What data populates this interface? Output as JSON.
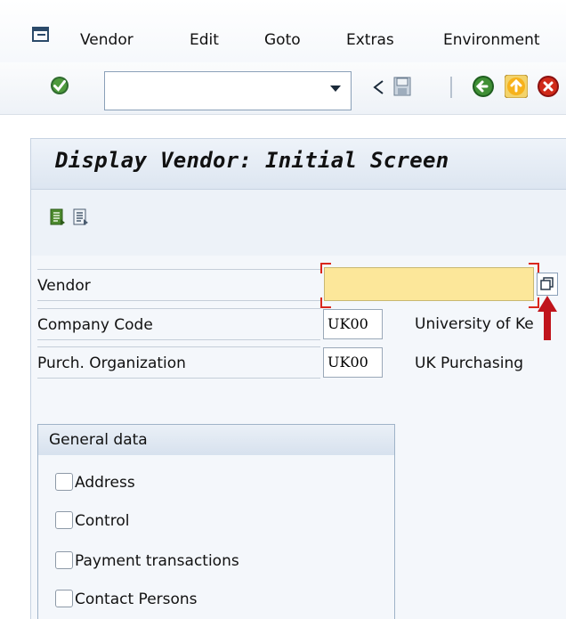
{
  "menubar": {
    "items": [
      {
        "label": "Vendor"
      },
      {
        "label": "Edit"
      },
      {
        "label": "Goto"
      },
      {
        "label": "Extras"
      },
      {
        "label": "Environment"
      }
    ]
  },
  "toolbar": {
    "command_field_value": "",
    "icons": [
      "enter-icon",
      "dropdown-arrow-icon",
      "back-icon",
      "save-icon",
      "back-green-icon",
      "exit-icon",
      "cancel-icon"
    ]
  },
  "title": "Display Vendor:  Initial Screen",
  "fields": {
    "vendor": {
      "label": "Vendor",
      "value": ""
    },
    "company_code": {
      "label": "Company Code",
      "value": "UK00",
      "description": "University of Ke"
    },
    "purch_org": {
      "label": "Purch. Organization",
      "value": "UK00",
      "description": "UK Purchasing"
    }
  },
  "general_data": {
    "title": "General data",
    "items": [
      {
        "label": "Address",
        "checked": false
      },
      {
        "label": "Control",
        "checked": false
      },
      {
        "label": "Payment transactions",
        "checked": false
      },
      {
        "label": "Contact Persons",
        "checked": false
      }
    ]
  },
  "colors": {
    "required_field": "#fce79a",
    "highlight_bracket": "#d9261c",
    "annotation_arrow": "#c0141c"
  }
}
